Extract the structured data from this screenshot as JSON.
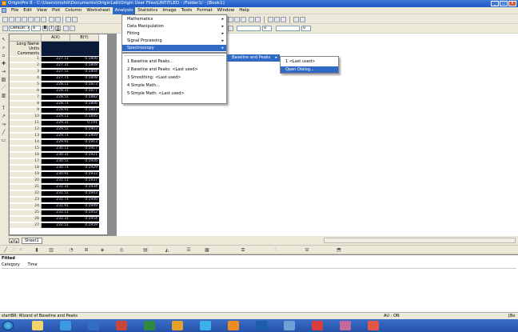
{
  "window": {
    "title": "OriginPro 8 - C:\\Users\\mohit\\Documents\\OriginLab\\Origin User Files\\UNTITLED - /Folder1/ - [Book1]",
    "min": "_",
    "max": "□",
    "close": "x"
  },
  "menubar": [
    "File",
    "Edit",
    "View",
    "Plot",
    "Column",
    "Worksheet",
    "Analysis",
    "Statistics",
    "Image",
    "Tools",
    "Format",
    "Window",
    "Help"
  ],
  "toolbar": {
    "font_combo": "Default: A",
    "size_combo": "8",
    "bold": "B",
    "italic": "I",
    "underline": "U",
    "line_width": "0",
    "fill_width": "0"
  },
  "worksheet": {
    "columns": [
      "A(X)",
      "B(Y)"
    ],
    "header_rows": [
      "Long Name",
      "Units",
      "Comments"
    ],
    "rows": [
      {
        "n": "1",
        "a": "227.11",
        "b": "0.1806"
      },
      {
        "n": "2",
        "a": "227.31",
        "b": "0.1809"
      },
      {
        "n": "3",
        "a": "227.51",
        "b": "0.1804"
      },
      {
        "n": "4",
        "a": "227.71",
        "b": "0.1808"
      },
      {
        "n": "5",
        "a": "228.11",
        "b": "0.1873"
      },
      {
        "n": "6",
        "a": "228.31",
        "b": "0.1877"
      },
      {
        "n": "7",
        "a": "228.51",
        "b": "0.1882"
      },
      {
        "n": "8",
        "a": "228.71",
        "b": "0.1806"
      },
      {
        "n": "9",
        "a": "228.91",
        "b": "0.1807"
      },
      {
        "n": "10",
        "a": "229.11",
        "b": "0.1895"
      },
      {
        "n": "11",
        "a": "229.31",
        "b": "0.191"
      },
      {
        "n": "12",
        "a": "229.51",
        "b": "0.1903"
      },
      {
        "n": "13",
        "a": "229.71",
        "b": "0.1909"
      },
      {
        "n": "14",
        "a": "229.91",
        "b": "0.1913"
      },
      {
        "n": "15",
        "a": "230.11",
        "b": "0.1917"
      },
      {
        "n": "16",
        "a": "230.31",
        "b": "0.1921"
      },
      {
        "n": "17",
        "a": "230.51",
        "b": "0.1926"
      },
      {
        "n": "18",
        "a": "230.71",
        "b": "0.1929"
      },
      {
        "n": "19",
        "a": "230.91",
        "b": "0.1933"
      },
      {
        "n": "20",
        "a": "231.11",
        "b": "0.1937"
      },
      {
        "n": "21",
        "a": "231.31",
        "b": "0.1934"
      },
      {
        "n": "22",
        "a": "231.51",
        "b": "0.1943"
      },
      {
        "n": "23",
        "a": "231.71",
        "b": "0.1946"
      },
      {
        "n": "24",
        "a": "231.91",
        "b": "0.1949"
      },
      {
        "n": "25",
        "a": "232.11",
        "b": "0.1952"
      },
      {
        "n": "26",
        "a": "232.31",
        "b": "0.1954"
      },
      {
        "n": "27",
        "a": "232.51",
        "b": "0.1959"
      }
    ],
    "sheet_tab": "Sheet1"
  },
  "analysis_menu": [
    "Mathematics",
    "Data Manipulation",
    "Fitting",
    "Signal Processing",
    "Spectroscopy"
  ],
  "spectroscopy_menu": [
    "1 Baseline and Peaks...",
    "2 Baseline and Peaks: <Last used>",
    "3 Smoothing: <Last used>",
    "4 Simple Math...",
    "5 Simple Math: <Last used>"
  ],
  "baseline_menu": {
    "parent": "Baseline and Peaks",
    "items": [
      "1 <Last used>",
      "Open Dialog..."
    ]
  },
  "results": {
    "title": "Fitted",
    "cols": [
      "Category",
      "Time"
    ]
  },
  "status": {
    "left": "startBR: Wizard of Baseline and Peaks",
    "mid": "AU : ON",
    "right": "[Bo"
  }
}
